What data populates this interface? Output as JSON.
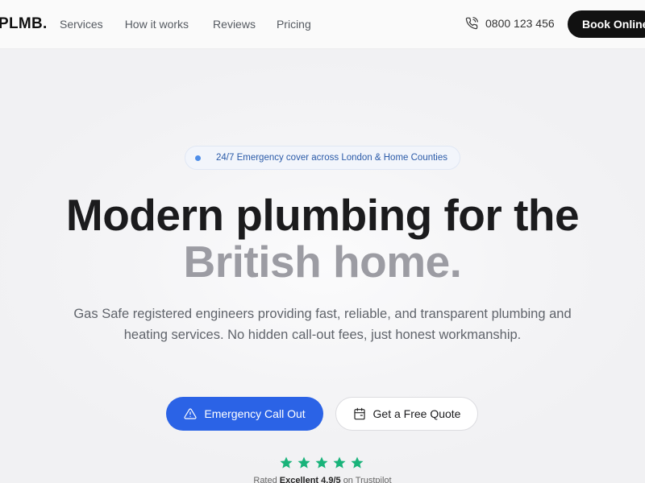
{
  "nav": {
    "logo": "PLMB.",
    "links": [
      "Services",
      "How it works",
      "Reviews",
      "Pricing"
    ],
    "phone": "0800 123 456",
    "book_label": "Book Online"
  },
  "hero": {
    "badge": "24/7 Emergency cover across London & Home Counties",
    "headline_line1": "Modern plumbing for the",
    "headline_line2": "British home.",
    "subtext": "Gas Safe registered engineers providing fast, reliable, and transparent plumbing and heating services. No hidden call-out fees, just honest workmanship.",
    "cta_primary": "Emergency Call Out",
    "cta_secondary": "Get a Free Quote",
    "rating_prefix": "Rated",
    "rating_word": "Excellent 4.9/5",
    "rating_suffix": "on Trustpilot",
    "star_count": 5
  },
  "icons": {
    "phone": "phone-icon",
    "warning": "warning-triangle-icon",
    "calendar": "calendar-icon",
    "star": "star-icon"
  },
  "colors": {
    "accent": "#2b63e6",
    "star": "#19b37a",
    "dark_button": "#111111",
    "headline_muted": "#9c9ca3",
    "badge_text": "#2a5aa8"
  }
}
